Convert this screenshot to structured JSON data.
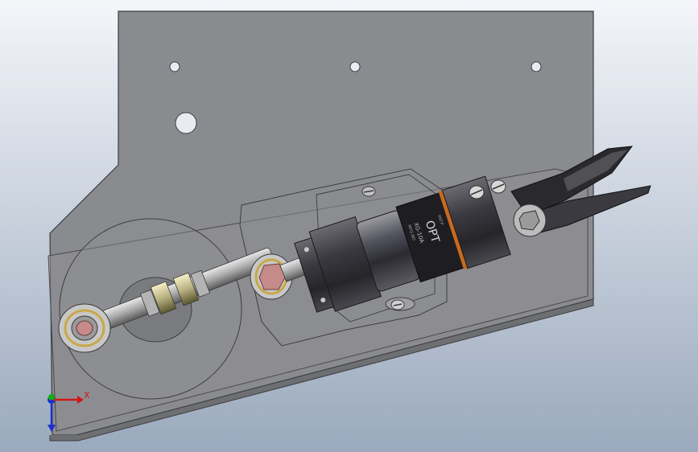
{
  "viewport": {
    "background_top": "#f4f6fa",
    "background_bottom": "#9aa9bd"
  },
  "cylinder": {
    "brand": "OPT",
    "model": "XG-10A",
    "spec_line_1": "MFG.NO",
    "spec_line_2": "PAT.P"
  },
  "triad": {
    "x_label": "X",
    "x_color": "#d01818",
    "y_color": "#10b010",
    "z_color": "#1830d0"
  },
  "colors": {
    "plate": "#8a8b8f",
    "plate_edge": "#4a4a4e",
    "brass_ring": "#c8a848",
    "bushing": "#c68a8a",
    "orange_band": "#c86a20"
  }
}
